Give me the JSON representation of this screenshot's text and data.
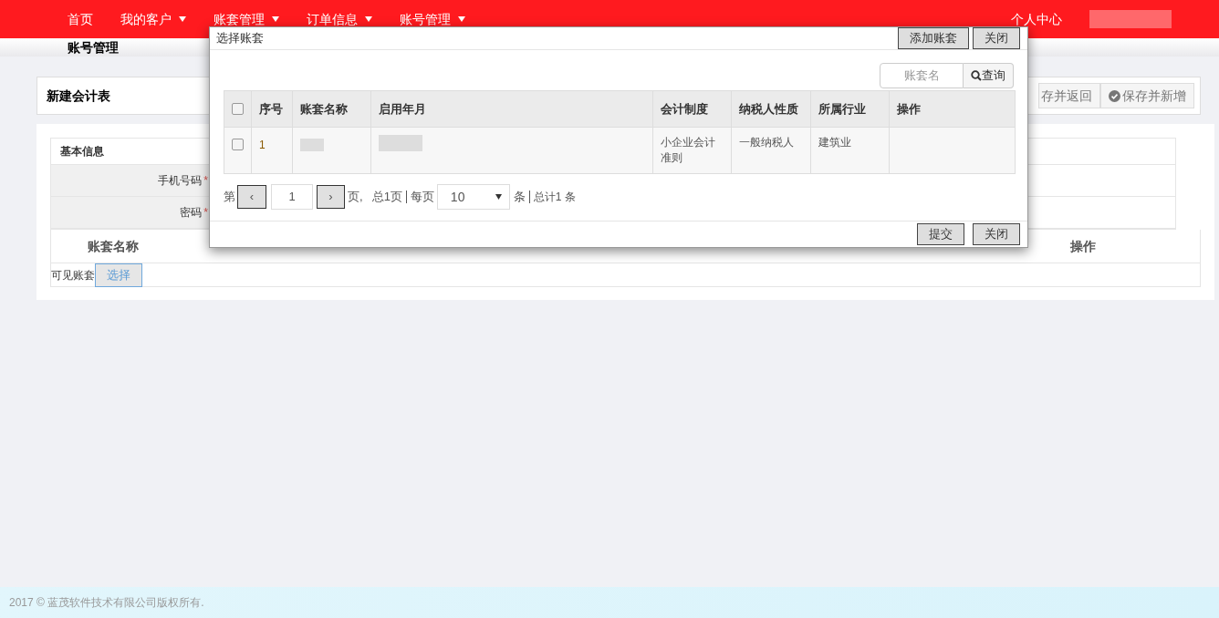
{
  "nav": {
    "items": [
      {
        "label": "首页",
        "dropdown": false
      },
      {
        "label": "我的客户",
        "dropdown": true
      },
      {
        "label": "账套管理",
        "dropdown": true
      },
      {
        "label": "订单信息",
        "dropdown": true
      },
      {
        "label": "账号管理",
        "dropdown": true
      }
    ],
    "user_link": "个人中心",
    "user_redacted": true
  },
  "breadcrumb": "账号管理",
  "form_header": {
    "title": "新建会计表",
    "buttons": [
      {
        "label": "存并返回"
      },
      {
        "label": "保存并新增",
        "icon": true
      }
    ]
  },
  "form": {
    "section": "基本信息",
    "fields": [
      {
        "label": "手机号码",
        "required_mark": "*"
      },
      {
        "label": "密码",
        "required_mark": "*"
      }
    ],
    "columns": [
      "账套名称",
      "操作"
    ],
    "visible_label": "可见账套",
    "select_button": "选择"
  },
  "dialog": {
    "title": "选择账套",
    "header_buttons": [
      "添加账套",
      "关闭"
    ],
    "search": {
      "placeholder": "账套名",
      "button": "查询"
    },
    "table": {
      "all_checked": false,
      "columns": [
        "序号",
        "账套名称",
        "启用年月",
        "会计制度",
        "纳税人性质",
        "所属行业",
        "操作"
      ],
      "rows": [
        {
          "checked": false,
          "index": "1",
          "name_redacted": true,
          "date_redacted": true,
          "system": "小企业会计准则",
          "taxpayer": "一般纳税人",
          "industry": "建筑业"
        }
      ]
    },
    "pagination": {
      "prefix": "第",
      "prev": "‹",
      "page": "1",
      "next": "›",
      "page_suffix": "页,",
      "total_pages": "总1页",
      "per_page_label": "每页",
      "per_page": "10",
      "unit": "条",
      "total": "总计1 条"
    },
    "footer_buttons": [
      "提交",
      "关闭"
    ]
  },
  "footer": "2017 © 蓝茂软件技术有限公司版权所有."
}
